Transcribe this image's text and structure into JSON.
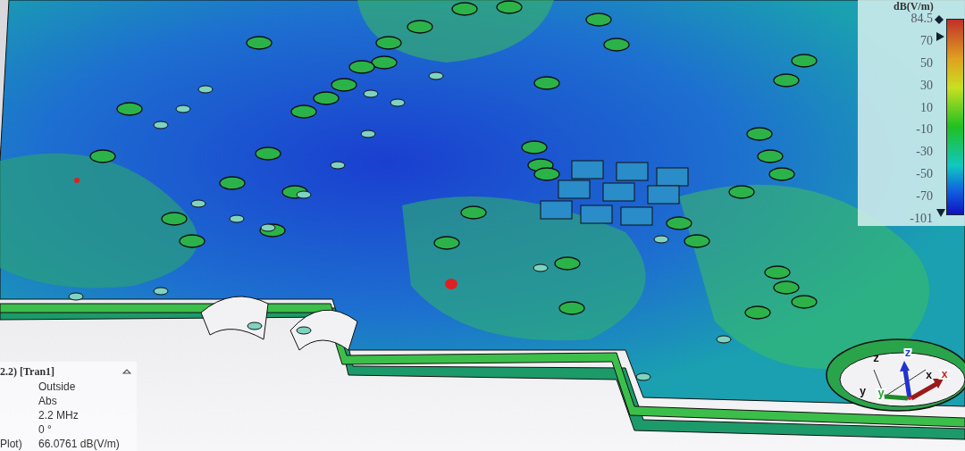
{
  "legend": {
    "unit": "dB(V/m)",
    "ticks": [
      "84.5",
      "70",
      "50",
      "30",
      "10",
      "-10",
      "-30",
      "-50",
      "-70",
      "-101"
    ]
  },
  "info_panel": {
    "header": "2.2) [Tran1]",
    "rows": [
      {
        "value": "Outside"
      },
      {
        "value": "Abs"
      },
      {
        "value": "2.2 MHz"
      },
      {
        "value": "0 °"
      },
      {
        "label": "Plot)",
        "value": "66.0761 dB(V/m)"
      }
    ]
  },
  "axes": {
    "labels": [
      "z",
      "x",
      "y"
    ],
    "badges": [
      {
        "text": "z",
        "color": "#1f3fe0"
      },
      {
        "text": "x",
        "color": "#d02020"
      },
      {
        "text": "y",
        "color": "#20a030"
      }
    ]
  }
}
